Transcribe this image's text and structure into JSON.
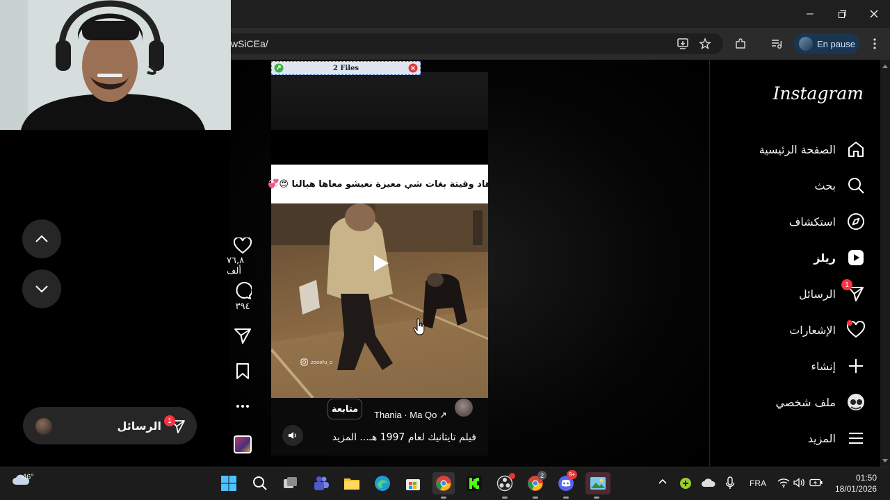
{
  "browser": {
    "url_visible": "wSiCEa/",
    "profile_label": "En pause"
  },
  "files_bar": {
    "label": "2 Files"
  },
  "instagram": {
    "logo": "Instagram",
    "nav": [
      {
        "label": "الصفحة الرئيسية",
        "icon": "home-icon"
      },
      {
        "label": "بحث",
        "icon": "search-icon"
      },
      {
        "label": "استكشاف",
        "icon": "explore-icon"
      },
      {
        "label": "ريلز",
        "icon": "reels-icon"
      },
      {
        "label": "الرسائل",
        "icon": "messages-icon",
        "badge": "1"
      },
      {
        "label": "الإشعارات",
        "icon": "heart-icon"
      },
      {
        "label": "إنشاء",
        "icon": "plus-icon"
      },
      {
        "label": "ملف شخصي",
        "icon": "avatar-icon"
      },
      {
        "label": "المزيد",
        "icon": "menu-icon"
      }
    ],
    "reel": {
      "caption_overlay": "هاد وقيتة بغات شي معيزة نعيشو معاها هبالنا 😍💞",
      "watermark": "zooofu_o",
      "author": "Thania · Ma Qo ↗",
      "follow_label": "متابعة",
      "description": "فيلم تايتانيك لعام 1997 هـ... المزيد"
    },
    "actions": {
      "likes": "٧٦,٨ ألف",
      "comments": "٣٩٤"
    },
    "messages_pill": {
      "label": "الرسائل",
      "badge": "1"
    }
  },
  "taskbar": {
    "weather_temp": "46°",
    "language": "FRA",
    "time": "01:50",
    "date": "18/01/2026",
    "badges": {
      "chrome_profile": "2",
      "discord": "9+"
    }
  }
}
